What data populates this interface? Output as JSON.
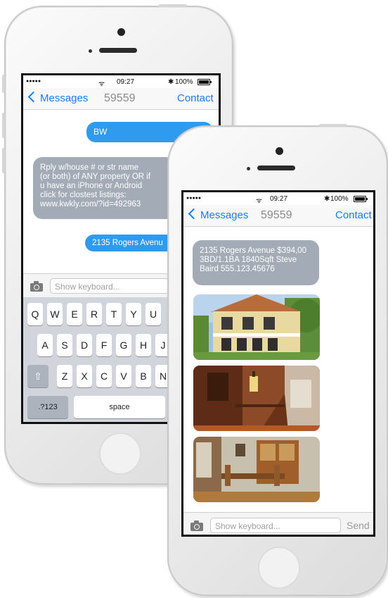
{
  "back_phone": {
    "status": {
      "carrier_dots": "●●●●●",
      "time": "09:27",
      "bluetooth": "✱",
      "battery_text": "100%"
    },
    "nav": {
      "back_label": "Messages",
      "title": "59559",
      "contact_label": "Contact"
    },
    "messages": [
      {
        "direction": "out",
        "text": "BW"
      },
      {
        "direction": "in",
        "lines": [
          "Rply w/house # or str name",
          "(or both) of ANY property OR if",
          "u have an iPhone or Android",
          "click for clostest listings:",
          "www.kwkly.com/?id=492963"
        ]
      },
      {
        "direction": "out",
        "text": "2135 Rogers Avenu"
      }
    ],
    "input_placeholder": "Show keyboard...",
    "keyboard": {
      "row1": [
        "Q",
        "W",
        "E",
        "R",
        "T",
        "Y",
        "U"
      ],
      "row2": [
        "A",
        "S",
        "D",
        "F",
        "G",
        "H",
        "J"
      ],
      "row3": [
        "Z",
        "X",
        "C",
        "V",
        "B",
        "N"
      ],
      "shift_icon": "⇧",
      "numbers_label": ".?123",
      "space_label": "space"
    }
  },
  "front_phone": {
    "status": {
      "carrier_dots": "●●●●●",
      "time": "09:27",
      "bluetooth": "✱",
      "battery_text": "100%"
    },
    "nav": {
      "back_label": "Messages",
      "title": "59559",
      "contact_label": "Contact"
    },
    "message": {
      "lines": [
        "2135 Rogers Avenue $394,00",
        "3BD/1.1BA 1840Sqft Steve",
        "Baird  555.123.45676"
      ]
    },
    "photos": [
      "house-exterior-photo",
      "interior-staircase-photo",
      "dining-room-photo"
    ],
    "input_placeholder": "Show keyboard...",
    "send_label": "Send"
  },
  "colors": {
    "accent_blue": "#1a7cf0",
    "outgoing_bubble": "#2f9bef",
    "incoming_bubble": "#a3acb6"
  }
}
